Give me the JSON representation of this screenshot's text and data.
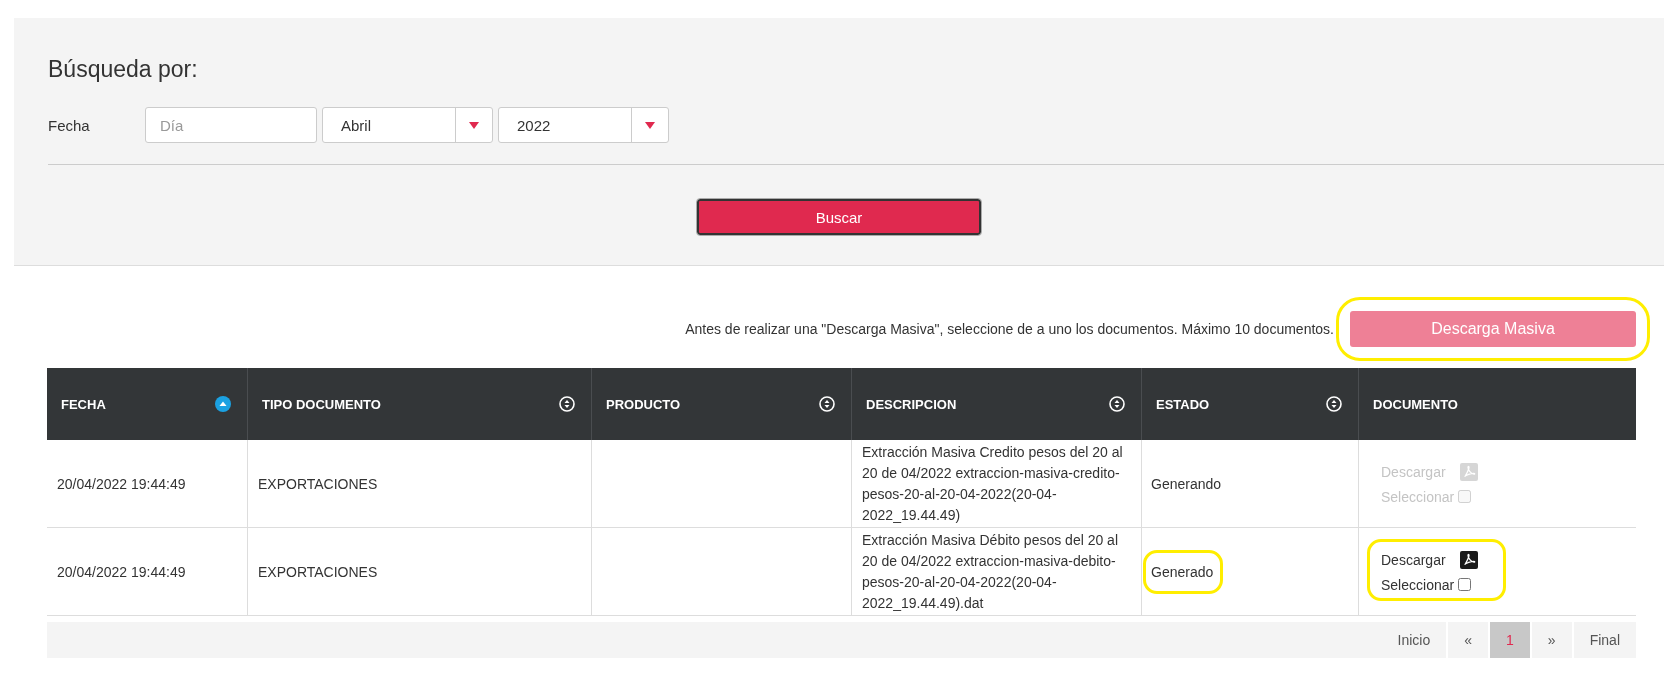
{
  "search_panel": {
    "title": "Búsqueda por:",
    "date_label": "Fecha",
    "day_field": {
      "placeholder": "Día"
    },
    "month_select": {
      "value": "Abril"
    },
    "year_select": {
      "value": "2022"
    },
    "search_button": "Buscar"
  },
  "bulk": {
    "note": "Antes de realizar una \"Descarga Masiva\", seleccione de a uno los documentos. Máximo 10 documentos.",
    "button": {
      "label": "Descarga Masiva",
      "highlighted": true
    }
  },
  "table": {
    "columns": [
      {
        "label": "FECHA",
        "sorted": true
      },
      {
        "label": "TIPO DOCUMENTO",
        "sorted": false
      },
      {
        "label": "PRODUCTO",
        "sorted": false
      },
      {
        "label": "DESCRIPCION",
        "sorted": false
      },
      {
        "label": "ESTADO",
        "sorted": false
      },
      {
        "label": "DOCUMENTO"
      }
    ],
    "rows": [
      {
        "fecha": "20/04/2022 19:44:49",
        "tipo": "EXPORTACIONES",
        "descripcion": "Extracción Masiva Credito pesos del 20 al 20 de 04/2022 extraccion-masiva-credito-pesos-20-al-20-04-2022(20-04-2022_19.44.49)",
        "estado": {
          "text": "Generando",
          "highlighted": false
        },
        "documento": {
          "download": "Descargar",
          "select": "Seleccionar",
          "checked": false,
          "disabled": true,
          "highlighted": false
        }
      },
      {
        "fecha": "20/04/2022 19:44:49",
        "tipo": "EXPORTACIONES",
        "descripcion": "Extracción Masiva Débito pesos del 20 al 20 de 04/2022 extraccion-masiva-debito-pesos-20-al-20-04-2022(20-04-2022_19.44.49).dat",
        "estado": {
          "text": "Generado",
          "highlighted": true
        },
        "documento": {
          "download": "Descargar",
          "select": "Seleccionar",
          "checked": false,
          "disabled": false,
          "highlighted": true
        }
      }
    ]
  },
  "pagination": [
    {
      "label": "Inicio",
      "selected": false
    },
    {
      "label": "«",
      "selected": false
    },
    {
      "label": "1",
      "selected": true
    },
    {
      "label": "»",
      "selected": false
    },
    {
      "label": "Final",
      "selected": false
    }
  ]
}
